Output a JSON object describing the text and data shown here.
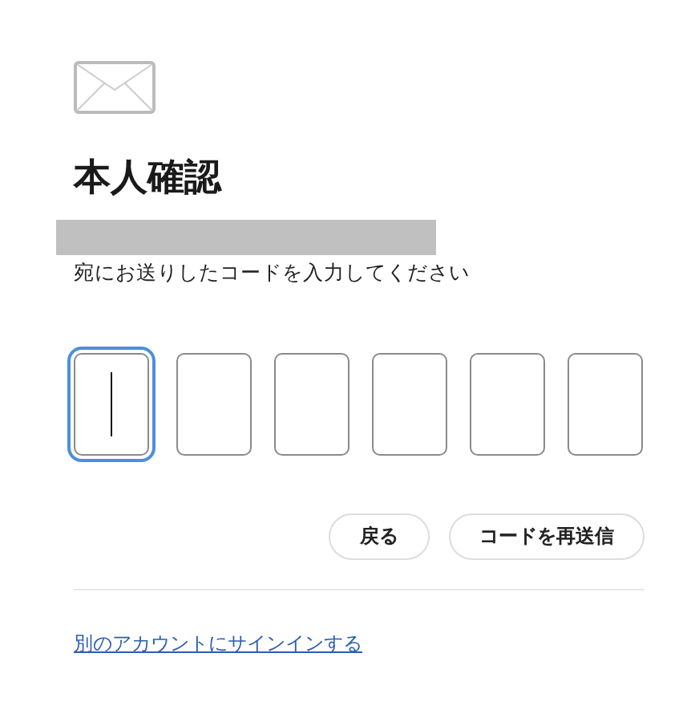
{
  "title": "本人確認",
  "redacted": true,
  "instruction": "宛にお送りしたコードを入力してください",
  "code_boxes": [
    {
      "focused": true
    },
    {
      "focused": false
    },
    {
      "focused": false
    },
    {
      "focused": false
    },
    {
      "focused": false
    },
    {
      "focused": false
    }
  ],
  "buttons": [
    {
      "label": "戻る"
    },
    {
      "label": "コードを再送信"
    }
  ],
  "link": "別のアカウントにサインインする"
}
